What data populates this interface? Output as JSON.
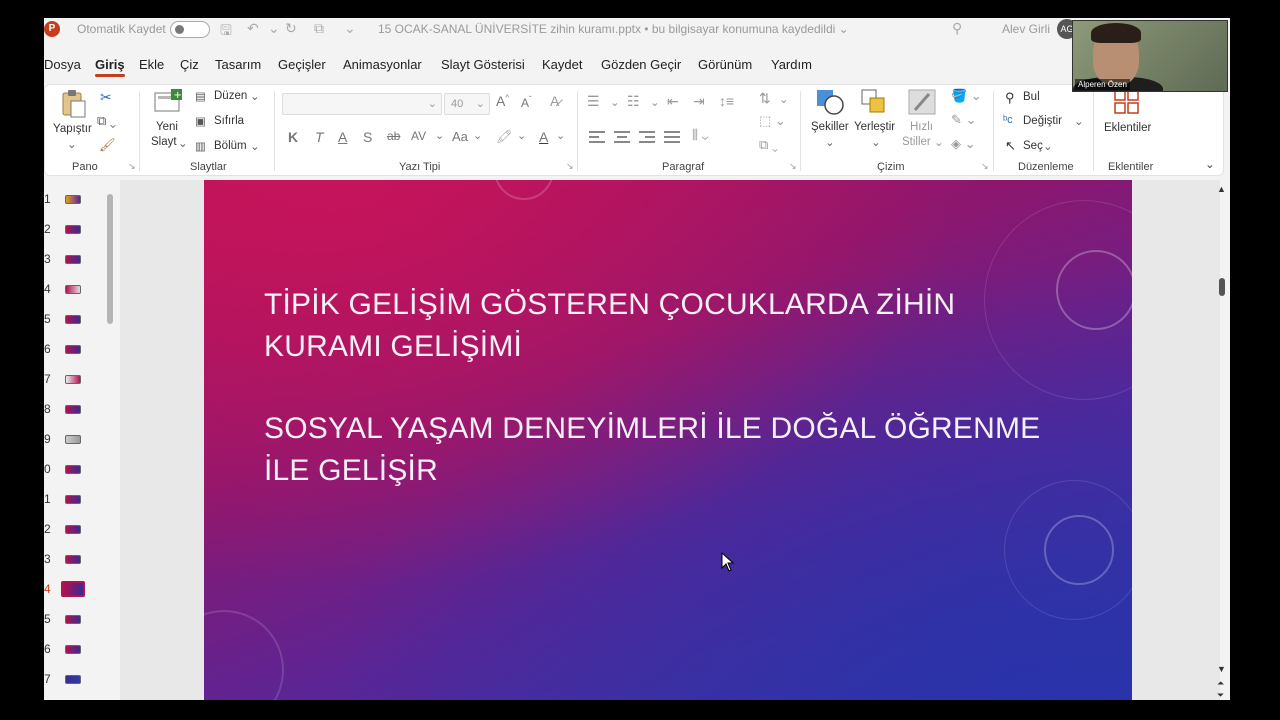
{
  "titlebar": {
    "app_icon": "P",
    "autosave_label": "Otomatik Kaydet",
    "doc_title": "15 OCAK-SANAL ÜNİVERSİTE zihin kuramı.pptx • bu bilgisayar konumuna kaydedildi ⌄",
    "user_name": "Alev Girli",
    "avatar_initials": "AG"
  },
  "tabs": [
    "Dosya",
    "Giriş",
    "Ekle",
    "Çiz",
    "Tasarım",
    "Geçişler",
    "Animasyonlar",
    "Slayt Gösterisi",
    "Kaydet",
    "Gözden Geçir",
    "Görünüm",
    "Yardım"
  ],
  "ribbon": {
    "pano": {
      "paste": "Yapıştır",
      "label": "Pano"
    },
    "slaytlar": {
      "new_slide_1": "Yeni",
      "new_slide_2": "Slayt",
      "layout": "Düzen",
      "reset": "Sıfırla",
      "section": "Bölüm",
      "label": "Slaytlar"
    },
    "yazi_tipi": {
      "font_size": "40",
      "bold": "K",
      "italic": "T",
      "underline": "A",
      "shadow": "S",
      "strike": "ab",
      "spacing": "AV",
      "case": "Aa",
      "label": "Yazı Tipi"
    },
    "paragraf": {
      "label": "Paragraf"
    },
    "cizim": {
      "shapes": "Şekiller",
      "arrange": "Yerleştir",
      "quick_styles_1": "Hızlı",
      "quick_styles_2": "Stiller",
      "label": "Çizim"
    },
    "duzenleme": {
      "find": "Bul",
      "replace": "Değiştir",
      "select": "Seç",
      "label": "Düzenleme"
    },
    "eklentiler": {
      "addins": "Eklentiler",
      "label": "Eklentiler"
    }
  },
  "slides": {
    "numbers": [
      "1",
      "2",
      "3",
      "4",
      "5",
      "6",
      "7",
      "8",
      "9",
      "0",
      "1",
      "2",
      "3",
      "4",
      "5",
      "6",
      "7"
    ],
    "selected_index": 13
  },
  "slide": {
    "line1": "TİPİK GELİŞİM GÖSTEREN ÇOCUKLARDA ZİHİN KURAMI GELİŞİMİ",
    "line2": "SOSYAL YAŞAM DENEYİMLERİ İLE DOĞAL ÖĞRENME İLE GELİŞİR"
  },
  "webcam": {
    "name": "Alperen Özen"
  }
}
